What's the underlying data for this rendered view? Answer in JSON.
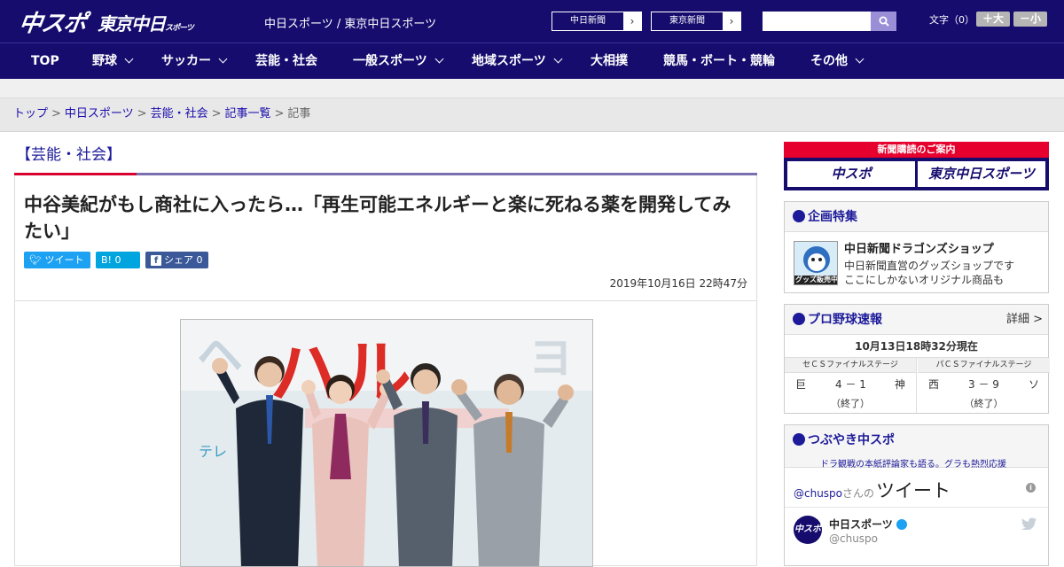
{
  "header": {
    "logo_main": "中スポ",
    "logo_tokyo": "東京中日",
    "logo_tokyo_small": "スポーツ",
    "site_name": "中日スポーツ / 東京中日スポーツ",
    "news_links": [
      "中日新聞",
      "東京新聞"
    ],
    "search_placeholder": "",
    "font_size_label": "文字（0）",
    "font_up": "＋大",
    "font_down": "－小"
  },
  "nav": {
    "items": [
      {
        "label": "TOP",
        "has_menu": false
      },
      {
        "label": "野球",
        "has_menu": true
      },
      {
        "label": "サッカー",
        "has_menu": true
      },
      {
        "label": "芸能・社会",
        "has_menu": false
      },
      {
        "label": "一般スポーツ",
        "has_menu": true
      },
      {
        "label": "地域スポーツ",
        "has_menu": true
      },
      {
        "label": "大相撲",
        "has_menu": false
      },
      {
        "label": "競馬・ボート・競輪",
        "has_menu": false
      },
      {
        "label": "その他",
        "has_menu": true
      }
    ]
  },
  "breadcrumb": {
    "items": [
      "トップ",
      "中日スポーツ",
      "芸能・社会",
      "記事一覧",
      "記事"
    ],
    "separator": ">"
  },
  "article": {
    "section": "【芸能・社会】",
    "headline": "中谷美紀がもし商社に入ったら…「再生可能エネルギーと楽に死ねる薬を開発してみたい」",
    "share": {
      "tweet": "ツイート",
      "hatena": "B!  0",
      "facebook": "シェア  0"
    },
    "date": "2019年10月16日 22時47分",
    "photo_text": "ハル"
  },
  "sidebar": {
    "promo_title": "新聞購読のご案内",
    "promo_boxes": [
      "中スポ",
      "東京中日スポーツ"
    ],
    "special": {
      "title": "企画特集",
      "badge": "グッズ販売中",
      "name": "中日新聞ドラゴンズショップ",
      "desc1": "中日新聞直営のグッズショップです",
      "desc2": "ここにしかないオリジナル商品も"
    },
    "baseball": {
      "title": "プロ野球速報",
      "detail": "詳細 >",
      "time": "10月13日18時32分現在",
      "games": [
        {
          "stage": "セＣＳファイナルステージ",
          "team1": "巨",
          "score": "4 － 1",
          "team2": "神",
          "status": "（終了）"
        },
        {
          "stage": "パＣＳファイナルステージ",
          "team1": "西",
          "score": "3 － 9",
          "team2": "ソ",
          "status": "（終了）"
        }
      ]
    },
    "tweets": {
      "title": "つぶやき中スポ",
      "subtitle": "ドラ観戦の本紙評論家も語る。グラも熱烈応援",
      "handle": "@chuspo",
      "handle_suffix": "さんの",
      "heading": "ツイート",
      "info": "i",
      "account_name": "中日スポーツ",
      "account_user": "@chuspo",
      "avatar_text": "中スポ"
    }
  },
  "colors": {
    "brand": "#150c6e",
    "accent_red": "#d7002f",
    "link": "#1d1b9a"
  }
}
